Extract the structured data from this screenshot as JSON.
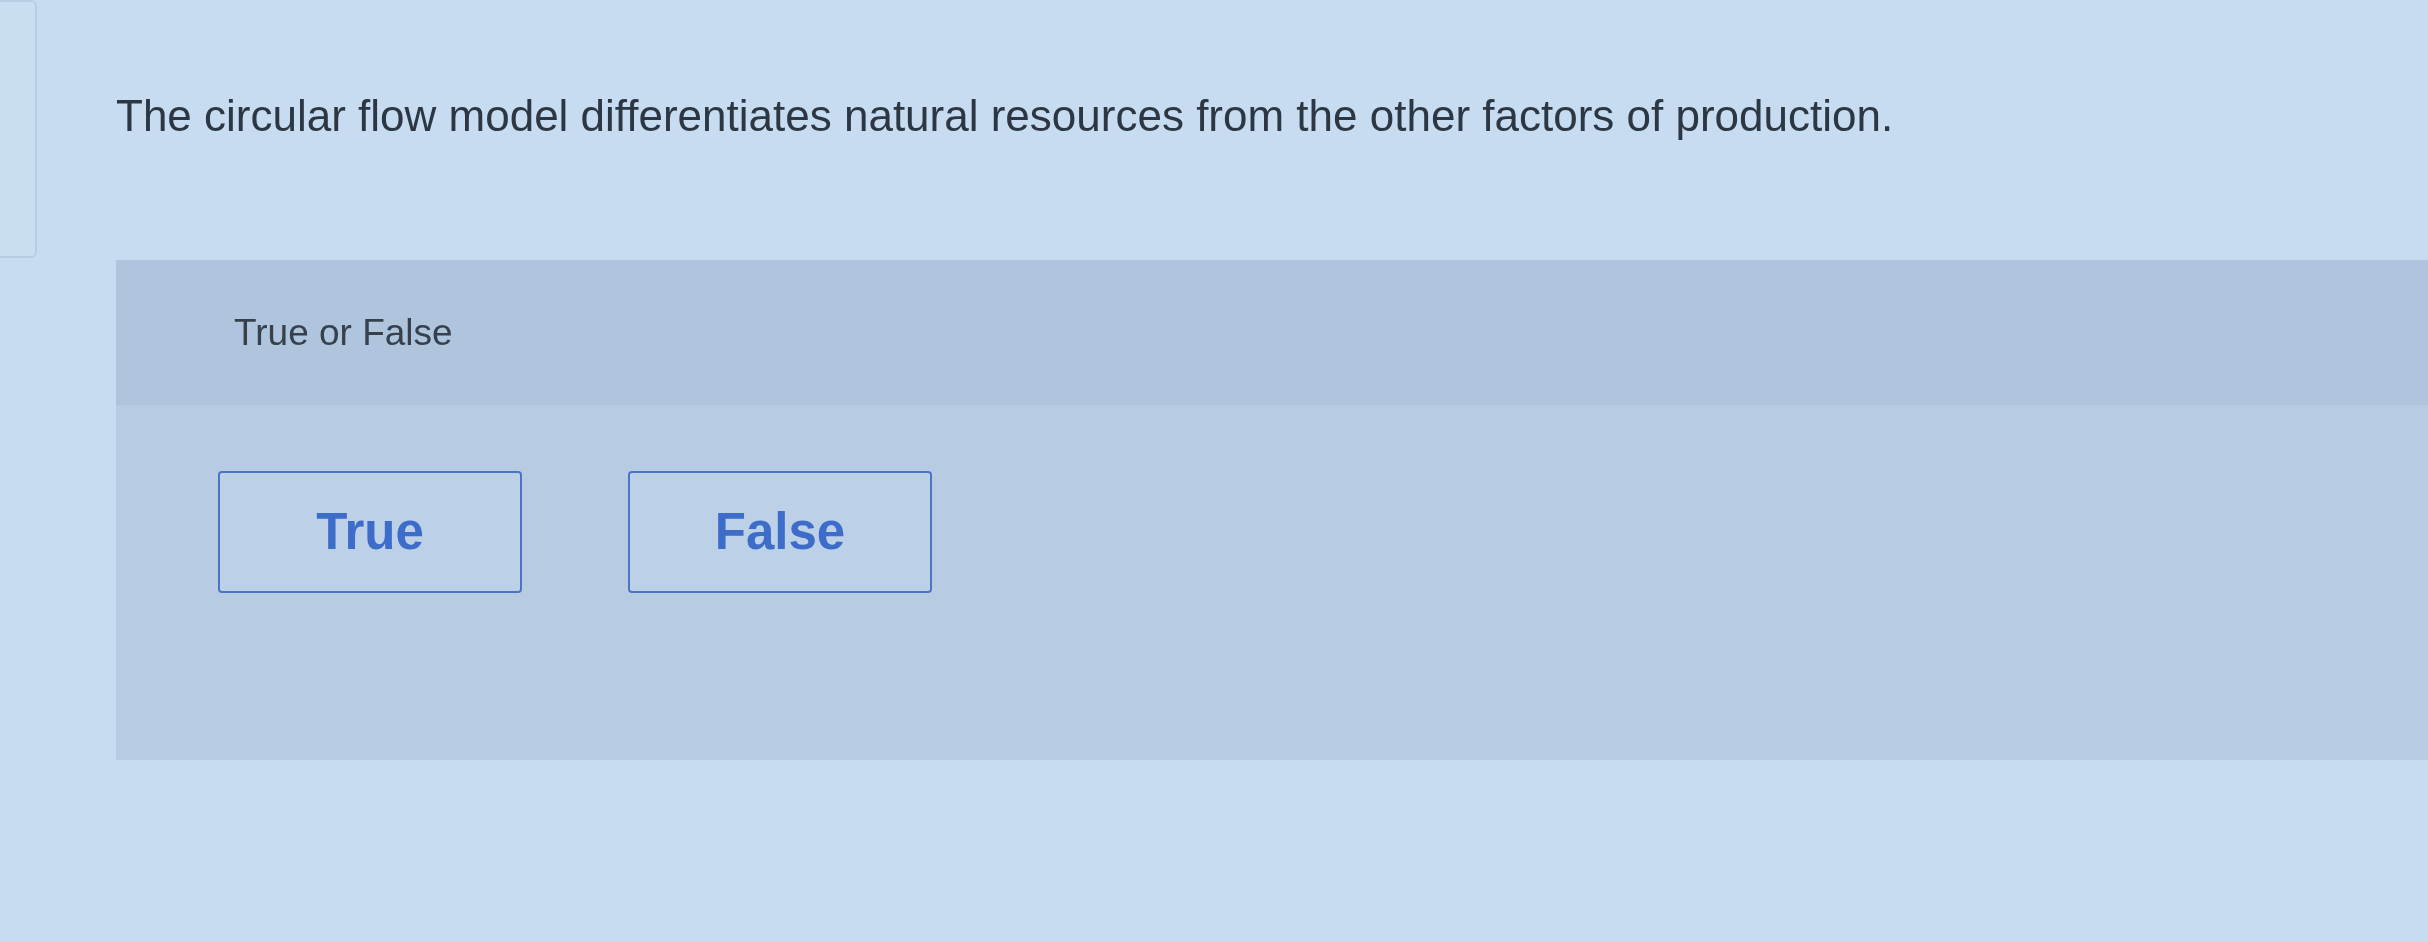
{
  "question": {
    "text": "The circular flow model differentiates natural resources from the other factors of production."
  },
  "answer_panel": {
    "label": "True or False",
    "options": [
      {
        "label": "True",
        "selected": false
      },
      {
        "label": "False",
        "selected": false
      }
    ]
  }
}
